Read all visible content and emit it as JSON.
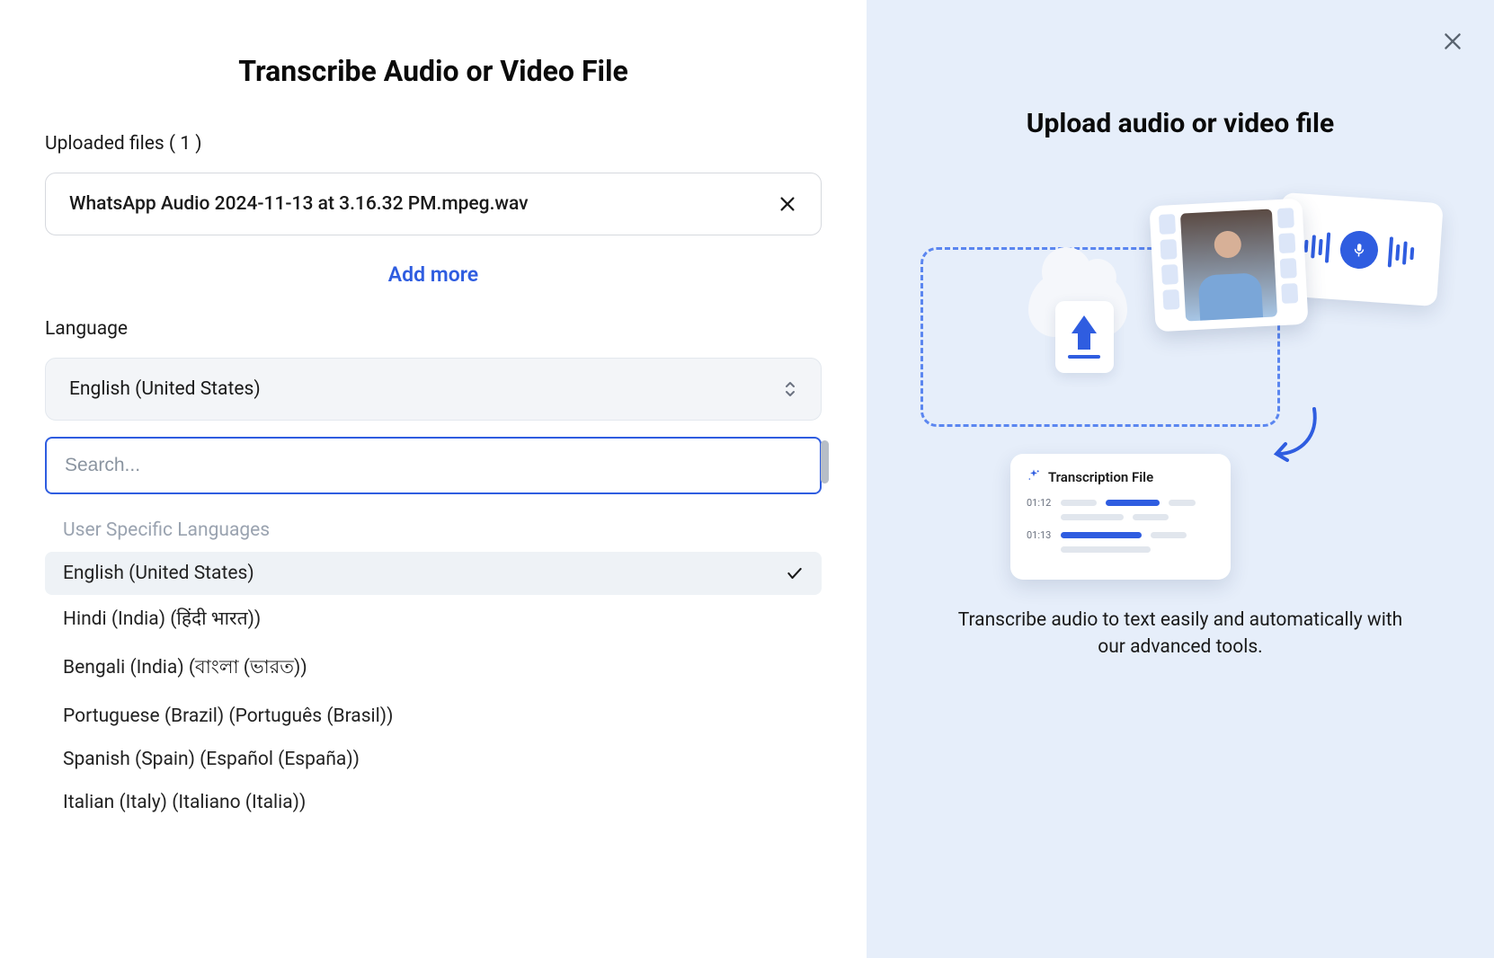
{
  "left": {
    "title": "Transcribe Audio or Video File",
    "uploaded_label": "Uploaded files ( 1 )",
    "file_name": "WhatsApp Audio 2024-11-13 at 3.16.32 PM.mpeg.wav",
    "add_more": "Add more",
    "language_label": "Language",
    "language_value": "English (United States)",
    "search_placeholder": "Search...",
    "section_label": "User Specific Languages",
    "options": [
      "English (United States)",
      "Hindi (India) (हिंदी भारत))",
      "Bengali (India) (বাংলা (ভারত))",
      "Portuguese (Brazil) (Português (Brasil))",
      "Spanish (Spain) (Español (España))",
      "Italian (Italy) (Italiano (Italia))"
    ],
    "selected_index": 0
  },
  "right": {
    "title": "Upload audio or video file",
    "illustration": {
      "trans_card_title": "Transcription File",
      "timestamps": [
        "01:12",
        "01:13"
      ]
    },
    "description": "Transcribe audio to text easily and automatically with our advanced tools."
  }
}
